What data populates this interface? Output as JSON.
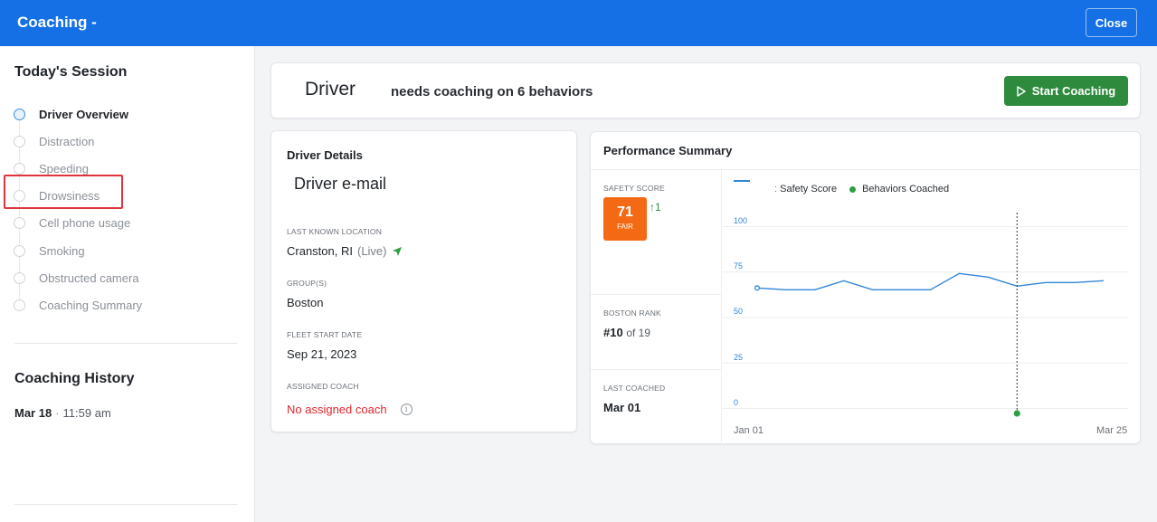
{
  "header": {
    "title": "Coaching -",
    "close_label": "Close"
  },
  "sidebar": {
    "session_heading": "Today's Session",
    "steps": [
      {
        "label": "Driver Overview",
        "active": true
      },
      {
        "label": "Distraction"
      },
      {
        "label": "Speeding"
      },
      {
        "label": "Drowsiness"
      },
      {
        "label": "Cell phone usage"
      },
      {
        "label": "Smoking"
      },
      {
        "label": "Obstructed camera"
      },
      {
        "label": "Coaching Summary"
      }
    ],
    "history_heading": "Coaching History",
    "history": [
      {
        "date": "Mar 18",
        "separator": "·",
        "time": "11:59 am"
      }
    ]
  },
  "banner": {
    "driver": "Driver",
    "message": "needs coaching on 6 behaviors",
    "start_label": "Start Coaching"
  },
  "details": {
    "heading": "Driver Details",
    "email": "Driver e-mail",
    "location_label": "LAST KNOWN LOCATION",
    "location_value": "Cranston, RI",
    "location_live": "(Live)",
    "groups_label": "GROUP(S)",
    "groups_value": "Boston",
    "start_label": "FLEET START DATE",
    "start_value": "Sep 21, 2023",
    "coach_label": "ASSIGNED COACH",
    "coach_value": "No assigned coach"
  },
  "performance": {
    "heading": "Performance Summary",
    "safety_label": "SAFETY SCORE",
    "score": "71",
    "score_grade": "FAIR",
    "score_delta": "↑1",
    "rank_label": "BOSTON RANK",
    "rank_value": "#10",
    "rank_of": "of 19",
    "last_label": "LAST COACHED",
    "last_value": "Mar 01"
  },
  "colors": {
    "header": "#1570e6",
    "start_button": "#2e8b3e",
    "score_box": "#f46a14",
    "line": "#2f86d8",
    "coached_dot": "#2e9e44",
    "highlight": "#e0343d",
    "no_coach": "#e0262c"
  },
  "chart_data": {
    "type": "line",
    "legend": [
      "ː Safety Score",
      "Behaviors Coached"
    ],
    "legend_placement": "top",
    "ylim": [
      0,
      100
    ],
    "yticks": [
      "100",
      "75",
      "50",
      "25",
      "0"
    ],
    "xticks": [
      "Jan 01",
      "Mar 25"
    ],
    "series": [
      {
        "name": "Safety Score",
        "values": [
          66,
          65,
          65,
          70,
          65,
          65,
          65,
          74,
          72,
          67,
          69,
          69,
          70
        ]
      }
    ],
    "coached_marker_index": 9,
    "coached_marker_value": 0
  }
}
